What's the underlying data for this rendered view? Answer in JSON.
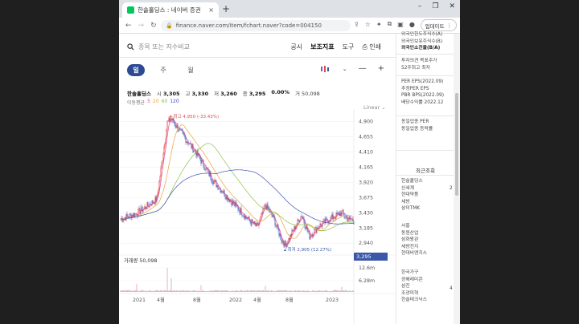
{
  "browser": {
    "tab_title": "한솔홀딩스 : 네이버 증권",
    "tab_close": "×",
    "new_tab": "+",
    "url": "finance.naver.com/item/fchart.naver?code=004150",
    "update_button": "업데이트",
    "win_controls": [
      "–",
      "❐",
      "✕"
    ]
  },
  "toolbar": {
    "search_placeholder": "종목 또는 지수비교",
    "menu": [
      "공시",
      "보조지표",
      "도구",
      "인쇄"
    ]
  },
  "periods": [
    "일",
    "주",
    "월"
  ],
  "stock": {
    "name": "한솔홀딩스",
    "open_label": "시",
    "open": "3,305",
    "high_label": "고",
    "high": "3,330",
    "low_label": "저",
    "low": "3,260",
    "close_label": "종",
    "close": "3,295",
    "change": "0.00%",
    "volume_label": "거",
    "volume": "50,098",
    "current_price_tag": "3,295"
  },
  "ma": {
    "label": "이동평균",
    "periods": [
      "5",
      "20",
      "60",
      "120"
    ],
    "colors": [
      "#e8488a",
      "#e8a33d",
      "#8bc34a",
      "#3f51b5"
    ]
  },
  "scale_label": "Linear",
  "chart_data": {
    "type": "candlestick",
    "y_ticks": [
      "4,900",
      "4,655",
      "4,410",
      "4,165",
      "3,920",
      "3,675",
      "3,430",
      "3,185",
      "2,940"
    ],
    "ylim": [
      2800,
      5000
    ],
    "x_ticks": [
      "2021",
      "4월",
      "8월",
      "2022",
      "4월",
      "8월",
      "2023"
    ],
    "max_annotation": "최고 4,950 (-33.43%)",
    "min_annotation": "최저 2,905 (12.27%)",
    "volume_label": "거래량",
    "volume_value": "50,098",
    "volume_ticks": [
      "12.6m",
      "6.28m"
    ],
    "key_points": [
      {
        "t": 0,
        "v": 3330
      },
      {
        "t": 20,
        "v": 3420
      },
      {
        "t": 45,
        "v": 3650
      },
      {
        "t": 58,
        "v": 4880
      },
      {
        "t": 63,
        "v": 4950
      },
      {
        "t": 75,
        "v": 4720
      },
      {
        "t": 95,
        "v": 4380
      },
      {
        "t": 115,
        "v": 3950
      },
      {
        "t": 135,
        "v": 3650
      },
      {
        "t": 150,
        "v": 3450
      },
      {
        "t": 160,
        "v": 3300
      },
      {
        "t": 170,
        "v": 3200
      },
      {
        "t": 180,
        "v": 3550
      },
      {
        "t": 190,
        "v": 3350
      },
      {
        "t": 200,
        "v": 3000
      },
      {
        "t": 205,
        "v": 2905
      },
      {
        "t": 215,
        "v": 3150
      },
      {
        "t": 225,
        "v": 3400
      },
      {
        "t": 235,
        "v": 3050
      },
      {
        "t": 245,
        "v": 3200
      },
      {
        "t": 260,
        "v": 3330
      },
      {
        "t": 275,
        "v": 3430
      },
      {
        "t": 283,
        "v": 3330
      },
      {
        "t": 290,
        "v": 3295
      }
    ],
    "volume_spikes": [
      {
        "t": 58,
        "v": 0.88
      },
      {
        "t": 63,
        "v": 0.5
      },
      {
        "t": 20,
        "v": 0.3
      },
      {
        "t": 100,
        "v": 0.25
      },
      {
        "t": 180,
        "v": 0.22
      },
      {
        "t": 275,
        "v": 0.18
      }
    ]
  },
  "side": {
    "top_items": [
      "외국인한도주식수(A)",
      "외국인보유주식수(B)",
      "외국인소진율(B/A)"
    ],
    "target_items": [
      "투자의견  목표주가",
      "52주최고  최저"
    ],
    "per_items": [
      "PER  EPS(2022.09)",
      "추정PER  EPS",
      "PBR  BPS(2022.09)",
      "배당수익률  2022.12"
    ],
    "sector_items": [
      "동일업종 PER",
      "동일업종 등락률"
    ],
    "recent_header": "최근조회",
    "recent_group1": [
      "한솔홀딩스",
      "신세계",
      "현대약품",
      "세방",
      "삼미TMK"
    ],
    "recent_group2": [
      "서흥",
      "동원산업",
      "삼화왕관",
      "세방전지",
      "현대비앤지스"
    ],
    "recent_group3": [
      "한국가구",
      "광해레미콘",
      "삼진",
      "조광피혁",
      "한솔테크닉스"
    ],
    "badges": [
      "2",
      "4"
    ]
  }
}
